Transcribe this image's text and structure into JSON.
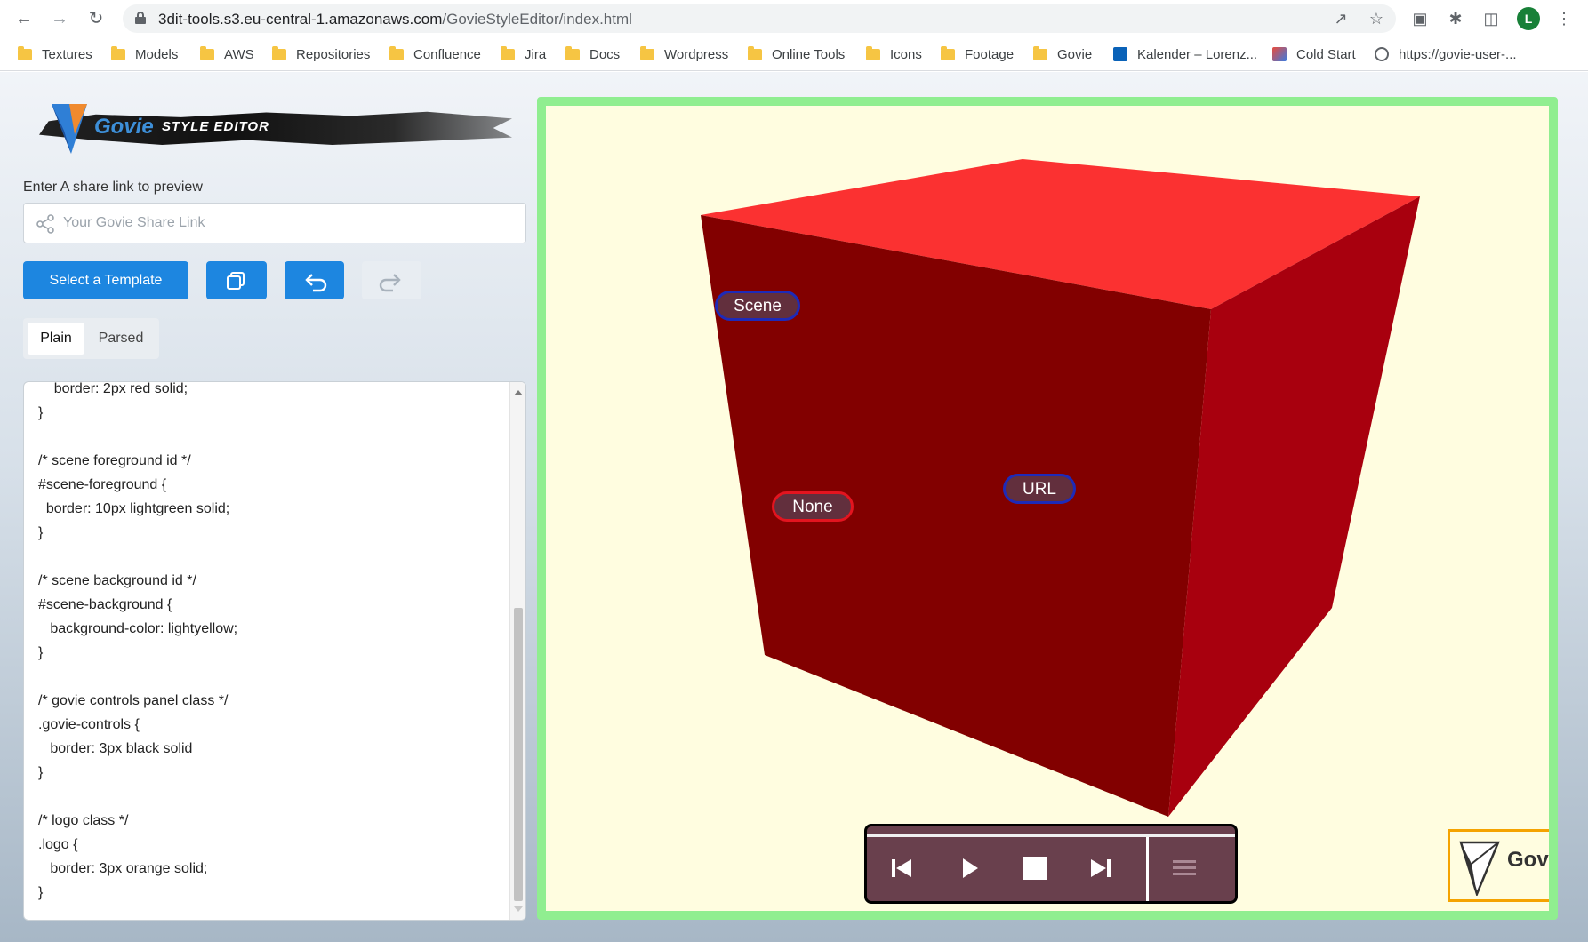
{
  "browser": {
    "url_host": "3dit-tools.s3.eu-central-1.amazonaws.com",
    "url_path": "/GovieStyleEditor/index.html",
    "avatar_letter": "L",
    "bookmarks": [
      "Textures",
      "Models",
      "AWS",
      "Repositories",
      "Confluence",
      "Jira",
      "Docs",
      "Wordpress",
      "Online Tools",
      "Icons",
      "Footage",
      "Govie",
      "Kalender – Lorenz...",
      "Cold Start",
      "https://govie-user-..."
    ]
  },
  "app": {
    "brand": "Govie",
    "subtitle": "STYLE EDITOR",
    "share_label": "Enter A share link to preview",
    "share_placeholder": "Your Govie Share Link",
    "select_template": "Select a Template",
    "tabs": [
      "Plain",
      "Parsed"
    ],
    "active_tab": "Plain",
    "code": "    border: 2px red solid;\n}\n\n/* scene foreground id */\n#scene-foreground {\n  border: 10px lightgreen solid;\n}\n\n/* scene background id */\n#scene-background {\n   background-color: lightyellow;\n}\n\n/* govie controls panel class */\n.govie-controls {\n   border: 3px black solid\n}\n\n/* logo class */\n.logo {\n   border: 3px orange solid;\n}"
  },
  "viewer": {
    "hotspots": [
      "Scene",
      "None",
      "URL"
    ],
    "logo_text": "Govie",
    "logo_mark": "®",
    "colors": {
      "foreground_border": "#90ee90",
      "background": "#fffde0",
      "cube_top": "#fb3131",
      "cube_left": "#820000",
      "cube_right": "#a8000e",
      "controls_border": "#000000",
      "logo_border": "#f5a300"
    }
  }
}
